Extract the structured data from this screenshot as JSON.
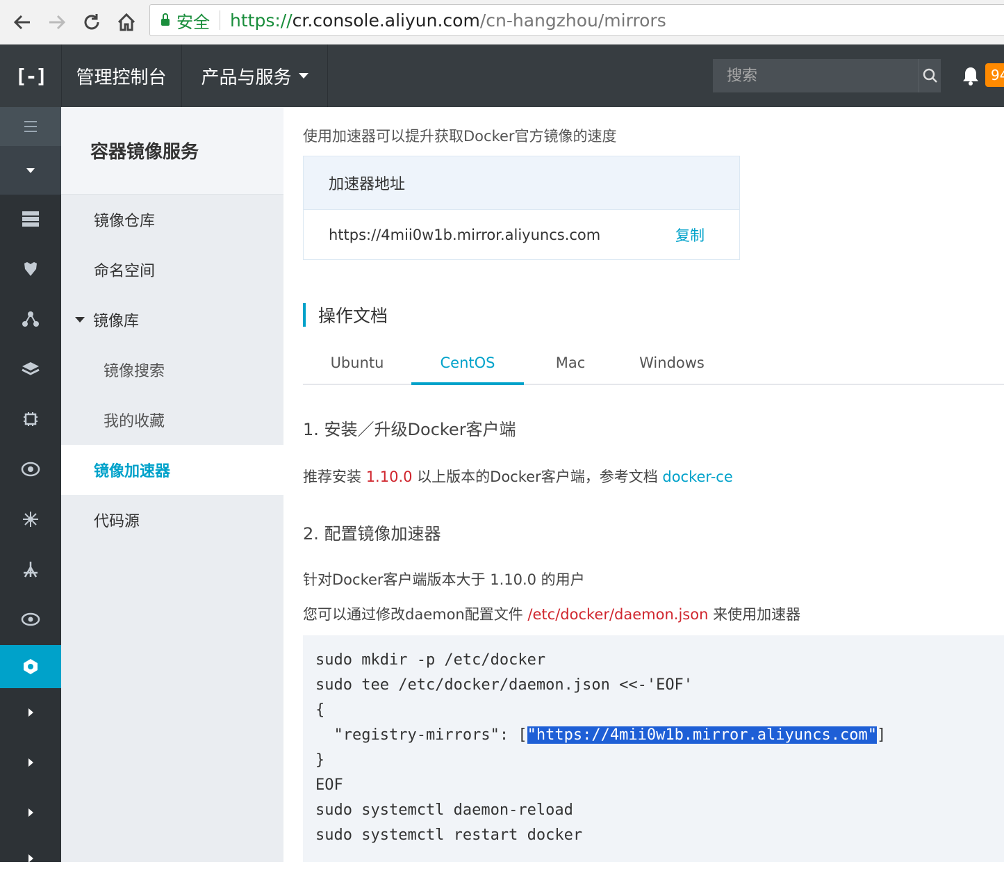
{
  "browser": {
    "secure_label": "安全",
    "url_scheme": "https://",
    "url_host": "cr.console.aliyun.com",
    "url_path": "/cn-hangzhou/mirrors"
  },
  "topnav": {
    "logo": "[-]",
    "console_label": "管理控制台",
    "products_label": "产品与服务",
    "search_placeholder": "搜索",
    "notification_count": "94"
  },
  "sidebar": {
    "title": "容器镜像服务",
    "items": [
      {
        "label": "镜像仓库"
      },
      {
        "label": "命名空间"
      },
      {
        "label": "镜像库"
      },
      {
        "label": "镜像搜索"
      },
      {
        "label": "我的收藏"
      },
      {
        "label": "镜像加速器"
      },
      {
        "label": "代码源"
      }
    ]
  },
  "main": {
    "intro": "使用加速器可以提升获取Docker官方镜像的速度",
    "accelerator": {
      "header": "加速器地址",
      "address": "https://4mii0w1b.mirror.aliyuncs.com",
      "copy_label": "复制"
    },
    "docs_title": "操作文档",
    "tabs": [
      {
        "label": "Ubuntu"
      },
      {
        "label": "CentOS"
      },
      {
        "label": "Mac"
      },
      {
        "label": "Windows"
      }
    ],
    "active_tab": "CentOS",
    "step1": {
      "title": "1. 安装／升级Docker客户端",
      "text_before": "推荐安装 ",
      "version": "1.10.0",
      "text_middle": " 以上版本的Docker客户端，参考文档 ",
      "doc_link": "docker-ce"
    },
    "step2": {
      "title": "2. 配置镜像加速器",
      "line1": "针对Docker客户端版本大于 1.10.0 的用户",
      "line2_before": "您可以通过修改daemon配置文件 ",
      "config_path": "/etc/docker/daemon.json",
      "line2_after": " 来使用加速器"
    },
    "code": {
      "line1": "sudo mkdir -p /etc/docker",
      "line2": "sudo tee /etc/docker/daemon.json <<-'EOF'",
      "line3": "{",
      "line4_prefix": "  \"registry-mirrors\": [",
      "line4_highlight": "\"https://4mii0w1b.mirror.aliyuncs.com\"",
      "line4_suffix": "]",
      "line5": "}",
      "line6": "EOF",
      "line7": "sudo systemctl daemon-reload",
      "line8": "sudo systemctl restart docker"
    }
  },
  "colors": {
    "accent": "#00a2ca",
    "topbar": "#373d41",
    "rail": "#2d3236",
    "red_text": "#d0262e",
    "badge": "#ff8a00",
    "secure_green": "#1a8e3c"
  }
}
